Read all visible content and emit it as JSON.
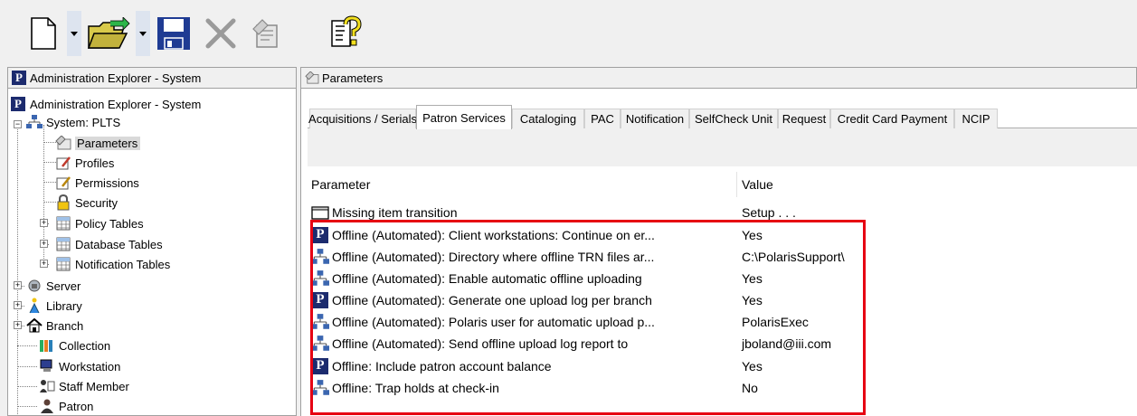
{
  "toolbar": {
    "buttons": [
      "new-document-icon",
      "open-folder-icon",
      "save-icon",
      "delete-icon",
      "properties-icon",
      "whats-this-help-icon"
    ]
  },
  "left_pane": {
    "header": "Administration Explorer - System",
    "tree": {
      "root": "Administration Explorer - System",
      "system": "System: PLTS",
      "parameters": "Parameters",
      "profiles": "Profiles",
      "permissions": "Permissions",
      "security": "Security",
      "policy_tables": "Policy Tables",
      "database_tables": "Database Tables",
      "notification_tables": "Notification Tables",
      "server": "Server",
      "library": "Library",
      "branch": "Branch",
      "collection": "Collection",
      "workstation": "Workstation",
      "staff_member": "Staff Member",
      "patron": "Patron"
    }
  },
  "right_pane": {
    "header": "Parameters",
    "tabs": [
      "Acquisitions / Serials",
      "Patron Services",
      "Cataloging",
      "PAC",
      "Notification",
      "SelfCheck Unit",
      "Request",
      "Credit Card Payment",
      "NCIP"
    ],
    "active_tab": "Patron Services",
    "columns": {
      "parameter": "Parameter",
      "value": "Value"
    },
    "rows": [
      {
        "icon": "folder-icon",
        "name": "Missing item transition",
        "value": "Setup . . ."
      },
      {
        "icon": "polaris-p-icon",
        "name": "Offline (Automated): Client workstations: Continue on er...",
        "value": "Yes"
      },
      {
        "icon": "network-icon",
        "name": "Offline (Automated): Directory where offline TRN files ar...",
        "value": "C:\\PolarisSupport\\"
      },
      {
        "icon": "network-icon",
        "name": "Offline (Automated): Enable automatic offline uploading",
        "value": "Yes"
      },
      {
        "icon": "polaris-p-icon",
        "name": "Offline (Automated): Generate one upload log per branch",
        "value": "Yes"
      },
      {
        "icon": "network-icon",
        "name": "Offline (Automated): Polaris user for automatic upload p...",
        "value": "PolarisExec"
      },
      {
        "icon": "network-icon",
        "name": "Offline (Automated): Send offline upload log report to",
        "value": "jboland@iii.com"
      },
      {
        "icon": "polaris-p-icon",
        "name": "Offline: Include patron account balance",
        "value": "Yes"
      },
      {
        "icon": "network-icon",
        "name": "Offline: Trap holds at check-in",
        "value": "No"
      }
    ]
  },
  "colors": {
    "highlight": "#e60012",
    "polaris_blue": "#1c2b6e"
  }
}
